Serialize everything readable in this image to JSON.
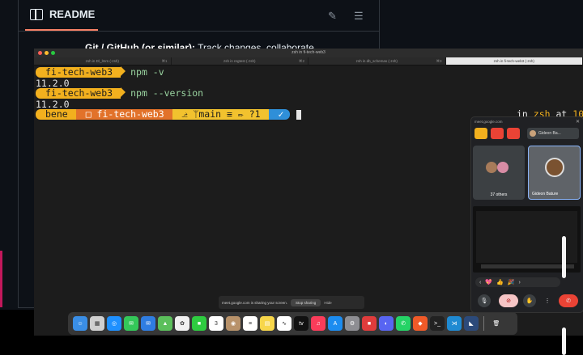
{
  "github": {
    "readme_title": "README",
    "bullet_bold": "Git / GitHub (or similar):",
    "bullet_rest": " Track changes, collaborate"
  },
  "terminal": {
    "window_title": "zsh in fi-tech-web3",
    "tabs": [
      {
        "label": "zsh in D\\_lmm (-zsh)",
        "shortcut": "⌘1",
        "active": false
      },
      {
        "label": "zsh in regtest (-zsh)",
        "shortcut": "⌘2",
        "active": false
      },
      {
        "label": "zsh in db_schemas (-zsh)",
        "shortcut": "⌘3",
        "active": false
      },
      {
        "label": "zsh in fi-tech-web3 (-zsh)",
        "shortcut": "",
        "active": true
      }
    ],
    "prompt_dir": "fi-tech-web3",
    "cmd1": "npm -v",
    "out1": "11.2.0",
    "cmd2": "npm --version",
    "out2": "11.2.0",
    "p10k_user": "bene",
    "p10k_dir": "□ fi-tech-web3",
    "p10k_git": "⎇ ᛘmain ≡ ✏ ?1",
    "p10k_ok": "✓",
    "right_prefix": "in ",
    "right_shell": "zsh",
    "right_at": " at ",
    "right_time": "10:"
  },
  "share_bar": {
    "text": "meet.google.com is sharing your screen.",
    "stop": "Stop sharing",
    "hide": "Hide"
  },
  "meet": {
    "url": "meet.google.com",
    "user": "Gideon Ba...",
    "others": "37 others",
    "tile_name": "Gideon Bature",
    "reactions": [
      "‹",
      "💖",
      "👍",
      "🎉",
      "›"
    ]
  },
  "dock": {
    "apps": [
      {
        "name": "finder-icon",
        "color": "#3a8ee6",
        "glyph": "☺"
      },
      {
        "name": "launchpad-icon",
        "color": "#d0d0d0",
        "glyph": "▦"
      },
      {
        "name": "safari-icon",
        "color": "#1e90ff",
        "glyph": "◎"
      },
      {
        "name": "messages-icon",
        "color": "#34c759",
        "glyph": "✉"
      },
      {
        "name": "mail-icon",
        "color": "#2f7de1",
        "glyph": "✉"
      },
      {
        "name": "maps-icon",
        "color": "#5bbf5b",
        "glyph": "▲"
      },
      {
        "name": "photos-icon",
        "color": "#f0f0f0",
        "glyph": "✿"
      },
      {
        "name": "facetime-icon",
        "color": "#2ecc40",
        "glyph": "■"
      },
      {
        "name": "calendar-icon",
        "color": "#ffffff",
        "glyph": "3"
      },
      {
        "name": "contacts-icon",
        "color": "#b8926a",
        "glyph": "◉"
      },
      {
        "name": "reminders-icon",
        "color": "#ffffff",
        "glyph": "≡"
      },
      {
        "name": "notes-icon",
        "color": "#f7d64a",
        "glyph": "▤"
      },
      {
        "name": "freeform-icon",
        "color": "#ffffff",
        "glyph": "∿"
      },
      {
        "name": "appletv-icon",
        "color": "#111111",
        "glyph": "tv"
      },
      {
        "name": "music-icon",
        "color": "#fa3c5a",
        "glyph": "♫"
      },
      {
        "name": "appstore-icon",
        "color": "#1c8cf0",
        "glyph": "A"
      },
      {
        "name": "settings-icon",
        "color": "#8e8e93",
        "glyph": "⚙"
      },
      {
        "name": "todo-icon",
        "color": "#e03c3c",
        "glyph": "■"
      },
      {
        "name": "discord-icon",
        "color": "#5865f2",
        "glyph": "◐"
      },
      {
        "name": "whatsapp-icon",
        "color": "#25d366",
        "glyph": "✆"
      },
      {
        "name": "brave-icon",
        "color": "#f05a28",
        "glyph": "◆"
      },
      {
        "name": "terminal-icon",
        "color": "#222222",
        "glyph": ">_"
      },
      {
        "name": "vscode-icon",
        "color": "#1f8ad2",
        "glyph": "⋊"
      },
      {
        "name": "wallet-icon",
        "color": "#2c4a7a",
        "glyph": "◣"
      }
    ],
    "trash": {
      "name": "trash-icon",
      "color": "#9a9a9a",
      "glyph": "🗑"
    }
  }
}
